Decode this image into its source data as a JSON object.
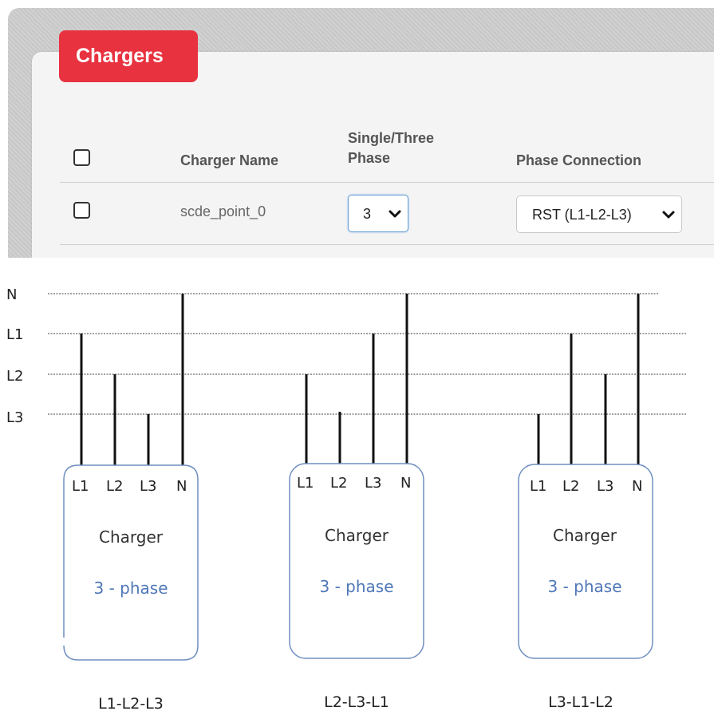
{
  "tab": {
    "title": "Chargers"
  },
  "table": {
    "headers": {
      "charger_name": "Charger Name",
      "phase_line1": "Single/Three",
      "phase_line2": "Phase",
      "phase_connection": "Phase Connection"
    },
    "rows": [
      {
        "name": "scde_point_0",
        "phase": "3",
        "connection": "RST (L1-L2-L3)"
      }
    ]
  },
  "diagram": {
    "lines": [
      "N",
      "L1",
      "L2",
      "L3"
    ],
    "chargers": [
      {
        "title": "Charger",
        "subtitle": "3 - phase",
        "terminals": [
          "L1",
          "L2",
          "L3",
          "N"
        ],
        "caption": "L1-L2-L3"
      },
      {
        "title": "Charger",
        "subtitle": "3 - phase",
        "terminals": [
          "L1",
          "L2",
          "L3",
          "N"
        ],
        "caption": "L2-L3-L1"
      },
      {
        "title": "Charger",
        "subtitle": "3 - phase",
        "terminals": [
          "L1",
          "L2",
          "L3",
          "N"
        ],
        "caption": "L3-L1-L2"
      }
    ],
    "colors": {
      "box_border": "#6f8fc0",
      "subtitle": "#4f77b8"
    }
  }
}
